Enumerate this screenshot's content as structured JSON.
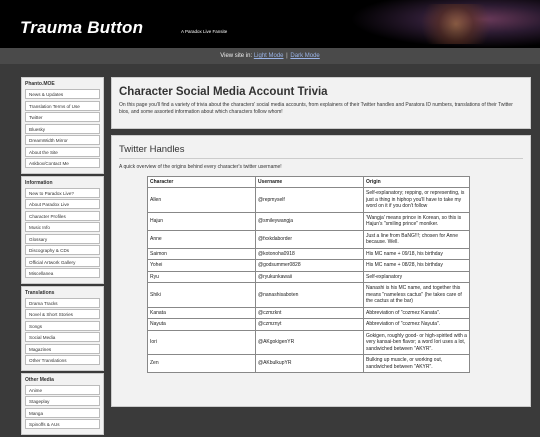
{
  "header": {
    "title": "Trauma Button",
    "subtitle": "A Paradox Live Fansite"
  },
  "viewbar": {
    "prefix": "View site in:",
    "light": "Light Mode",
    "sep": "|",
    "dark": "Dark Mode"
  },
  "sidebar": {
    "groups": [
      {
        "title": "Phanto.MOE",
        "items": [
          "News & Updates",
          "Translation Terms of Use",
          "Twitter",
          "Bluesky",
          "DreamWidth Mirror",
          "About the Site",
          "Askbox/Contact Me"
        ]
      },
      {
        "title": "Information",
        "items": [
          "New to Paradox Live?",
          "About Paradox Live",
          "Character Profiles",
          "Music Info",
          "Glossary",
          "Discography & CDs",
          "Official Artwork Gallery",
          "Miscellanea"
        ]
      },
      {
        "title": "Translations",
        "items": [
          "Drama Tracks",
          "Novel & Short Stories",
          "Songs",
          "Social Media",
          "Magazines",
          "Other Translations"
        ]
      },
      {
        "title": "Other Media",
        "items": [
          "Anime",
          "Stageplay",
          "Manga",
          "Spinoffs & AUs"
        ]
      }
    ]
  },
  "intro": {
    "title": "Character Social Media Account Trivia",
    "text": "On this page you'll find a variety of trivia about the characters' social media accounts, from explainers of their Twitter handles and Paratora ID numbers, translations of their Twitter bios, and some assorted information about which characters follow whom!"
  },
  "twitter": {
    "title": "Twitter Handles",
    "desc": "A quick overview of the origins behind every character's twitter username!",
    "headers": [
      "Character",
      "Username",
      "Origin"
    ],
    "rows": [
      [
        "Allen",
        "@repmyself",
        "Self-explanatory; repping, or representing, is just a thing in hiphop you'll have to take my word on it if you don't follow"
      ],
      [
        "Hajun",
        "@smileywangja",
        "'Wangja' means prince in Korean, so this is Hajun's \"smiling prince\" moniker."
      ],
      [
        "Anne",
        "@fxxkdaborder",
        "Just a line from BaNG!!!; chosen for Anne because. Well."
      ],
      [
        "Saimon",
        "@kotonoha0918",
        "His MC name + 09/18, his birthday"
      ],
      [
        "Yohei",
        "@godsummer0828",
        "His MC name + 08/28, his birthday"
      ],
      [
        "Ryu",
        "@ryukunkawaii",
        "Self-explanatory"
      ],
      [
        "Shiki",
        "@nanashisaboten",
        "Nanashi is his MC name, and together this means \"nameless cactus\" (he takes care of the cactus at the bar)"
      ],
      [
        "Kanata",
        "@czmzknt",
        "Abbreviation of \"cozmez Kanata\"."
      ],
      [
        "Nayuta",
        "@czmznyt",
        "Abbreviation of \"cozmez Nayuta\"."
      ],
      [
        "Iori",
        "@AKgokigenYR",
        "Gokigen, roughly good- or high-spirited with a very kansai-ben flavor; a word Iori uses a lot, sandwiched between \"AKYR\"."
      ],
      [
        "Zen",
        "@AKbulkupYR",
        "Bulking up muscle, or working out, sandwiched between \"AKYR\"."
      ]
    ]
  }
}
